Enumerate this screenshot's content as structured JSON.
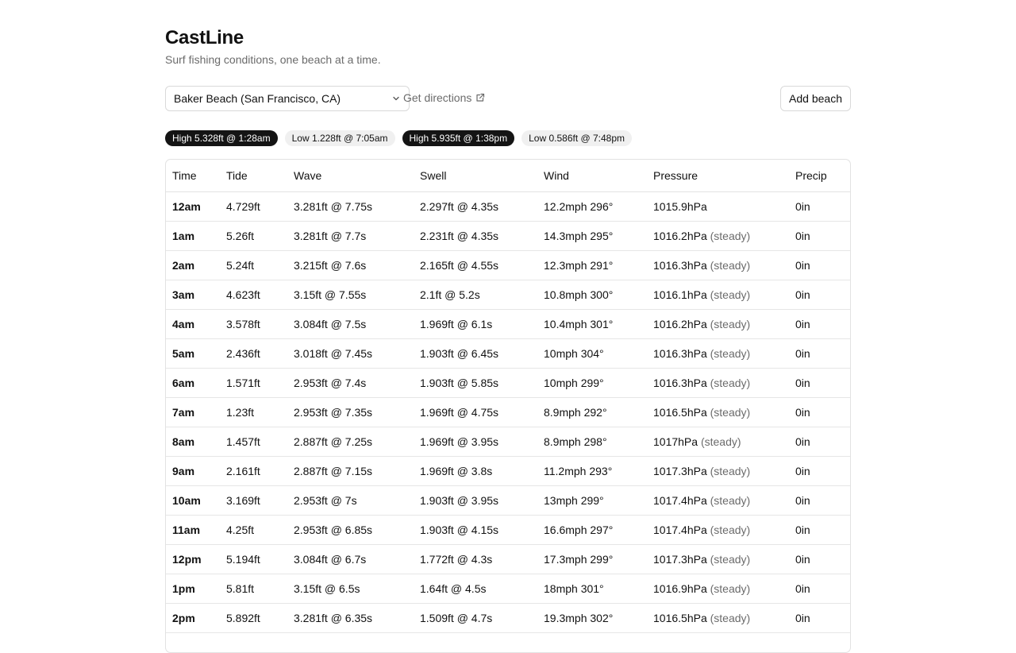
{
  "app": {
    "title": "CastLine",
    "subtitle": "Surf fishing conditions, one beach at a time."
  },
  "controls": {
    "selected_beach": "Baker Beach (San Francisco, CA)",
    "directions_label": "Get directions",
    "add_beach_label": "Add beach"
  },
  "tides": [
    {
      "label": "High 5.328ft @ 1:28am",
      "kind": "high"
    },
    {
      "label": "Low 1.228ft @ 7:05am",
      "kind": "low"
    },
    {
      "label": "High 5.935ft @ 1:38pm",
      "kind": "high"
    },
    {
      "label": "Low 0.586ft @ 7:48pm",
      "kind": "low"
    }
  ],
  "table": {
    "columns": [
      "Time",
      "Tide",
      "Wave",
      "Swell",
      "Wind",
      "Pressure",
      "Precip"
    ],
    "rows": [
      {
        "time": "12am",
        "tide": "4.729ft",
        "wave": "3.281ft @ 7.75s",
        "swell": "2.297ft @ 4.35s",
        "wind": "12.2mph 296°",
        "pressure": "1015.9hPa",
        "trend": "",
        "precip": "0in"
      },
      {
        "time": "1am",
        "tide": "5.26ft",
        "wave": "3.281ft @ 7.7s",
        "swell": "2.231ft @ 4.35s",
        "wind": "14.3mph 295°",
        "pressure": "1016.2hPa",
        "trend": "(steady)",
        "precip": "0in"
      },
      {
        "time": "2am",
        "tide": "5.24ft",
        "wave": "3.215ft @ 7.6s",
        "swell": "2.165ft @ 4.55s",
        "wind": "12.3mph 291°",
        "pressure": "1016.3hPa",
        "trend": "(steady)",
        "precip": "0in"
      },
      {
        "time": "3am",
        "tide": "4.623ft",
        "wave": "3.15ft @ 7.55s",
        "swell": "2.1ft @ 5.2s",
        "wind": "10.8mph 300°",
        "pressure": "1016.1hPa",
        "trend": "(steady)",
        "precip": "0in"
      },
      {
        "time": "4am",
        "tide": "3.578ft",
        "wave": "3.084ft @ 7.5s",
        "swell": "1.969ft @ 6.1s",
        "wind": "10.4mph 301°",
        "pressure": "1016.2hPa",
        "trend": "(steady)",
        "precip": "0in"
      },
      {
        "time": "5am",
        "tide": "2.436ft",
        "wave": "3.018ft @ 7.45s",
        "swell": "1.903ft @ 6.45s",
        "wind": "10mph 304°",
        "pressure": "1016.3hPa",
        "trend": "(steady)",
        "precip": "0in"
      },
      {
        "time": "6am",
        "tide": "1.571ft",
        "wave": "2.953ft @ 7.4s",
        "swell": "1.903ft @ 5.85s",
        "wind": "10mph 299°",
        "pressure": "1016.3hPa",
        "trend": "(steady)",
        "precip": "0in"
      },
      {
        "time": "7am",
        "tide": "1.23ft",
        "wave": "2.953ft @ 7.35s",
        "swell": "1.969ft @ 4.75s",
        "wind": "8.9mph 292°",
        "pressure": "1016.5hPa",
        "trend": "(steady)",
        "precip": "0in"
      },
      {
        "time": "8am",
        "tide": "1.457ft",
        "wave": "2.887ft @ 7.25s",
        "swell": "1.969ft @ 3.95s",
        "wind": "8.9mph 298°",
        "pressure": "1017hPa",
        "trend": "(steady)",
        "precip": "0in"
      },
      {
        "time": "9am",
        "tide": "2.161ft",
        "wave": "2.887ft @ 7.15s",
        "swell": "1.969ft @ 3.8s",
        "wind": "11.2mph 293°",
        "pressure": "1017.3hPa",
        "trend": "(steady)",
        "precip": "0in"
      },
      {
        "time": "10am",
        "tide": "3.169ft",
        "wave": "2.953ft @ 7s",
        "swell": "1.903ft @ 3.95s",
        "wind": "13mph 299°",
        "pressure": "1017.4hPa",
        "trend": "(steady)",
        "precip": "0in"
      },
      {
        "time": "11am",
        "tide": "4.25ft",
        "wave": "2.953ft @ 6.85s",
        "swell": "1.903ft @ 4.15s",
        "wind": "16.6mph 297°",
        "pressure": "1017.4hPa",
        "trend": "(steady)",
        "precip": "0in"
      },
      {
        "time": "12pm",
        "tide": "5.194ft",
        "wave": "3.084ft @ 6.7s",
        "swell": "1.772ft @ 4.3s",
        "wind": "17.3mph 299°",
        "pressure": "1017.3hPa",
        "trend": "(steady)",
        "precip": "0in"
      },
      {
        "time": "1pm",
        "tide": "5.81ft",
        "wave": "3.15ft @ 6.5s",
        "swell": "1.64ft @ 4.5s",
        "wind": "18mph 301°",
        "pressure": "1016.9hPa",
        "trend": "(steady)",
        "precip": "0in"
      },
      {
        "time": "2pm",
        "tide": "5.892ft",
        "wave": "3.281ft @ 6.35s",
        "swell": "1.509ft @ 4.7s",
        "wind": "19.3mph 302°",
        "pressure": "1016.5hPa",
        "trend": "(steady)",
        "precip": "0in"
      }
    ]
  }
}
